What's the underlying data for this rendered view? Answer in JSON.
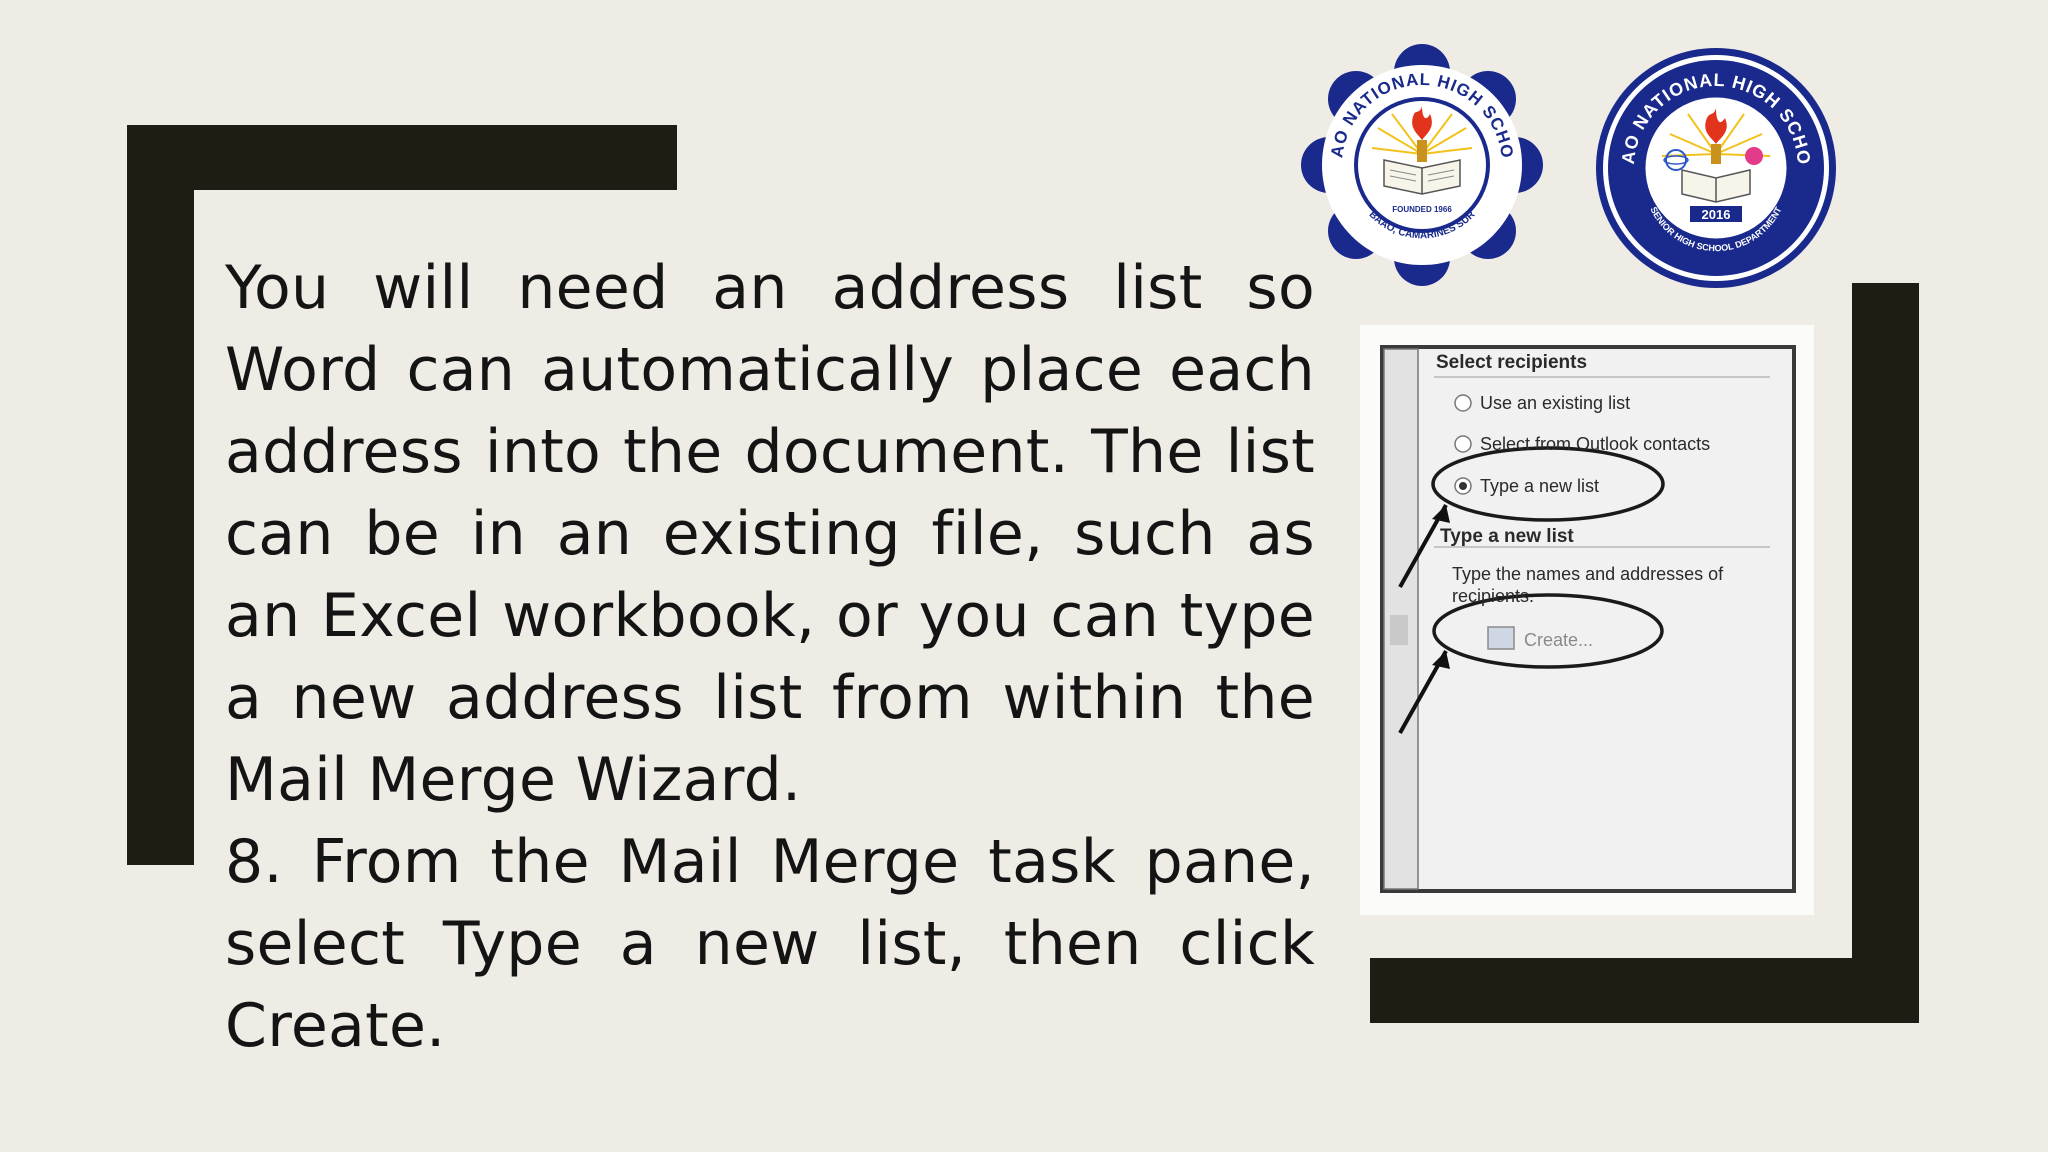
{
  "slide": {
    "paragraphs": [
      "You will need an address list so Word can automatically place each address into the document. The list can be in an existing file, such as an Excel workbook, or you can type a new address list from within the Mail Merge Wizard.",
      "8. From the Mail Merge task pane, select Type a new list, then click Create."
    ]
  },
  "logos": {
    "school": {
      "name": "BAAO NATIONAL HIGH SCHOOL",
      "founded": "FOUNDED 1966",
      "location": "BAAO, CAMARINES SUR"
    },
    "shs": {
      "name": "BAAO NATIONAL HIGH SCHOOL",
      "year": "2016",
      "department": "SENIOR HIGH SCHOOL DEPARTMENT"
    }
  },
  "wizard": {
    "section_select": "Select recipients",
    "options": [
      "Use an existing list",
      "Select from Outlook contacts",
      "Type a new list"
    ],
    "section_type": "Type a new list",
    "description": "Type the names and addresses of recipients.",
    "create_label": "Create..."
  },
  "colors": {
    "background": "#efece6",
    "bracket": "#1d1d14",
    "logo_navy": "#1a2a8c"
  }
}
